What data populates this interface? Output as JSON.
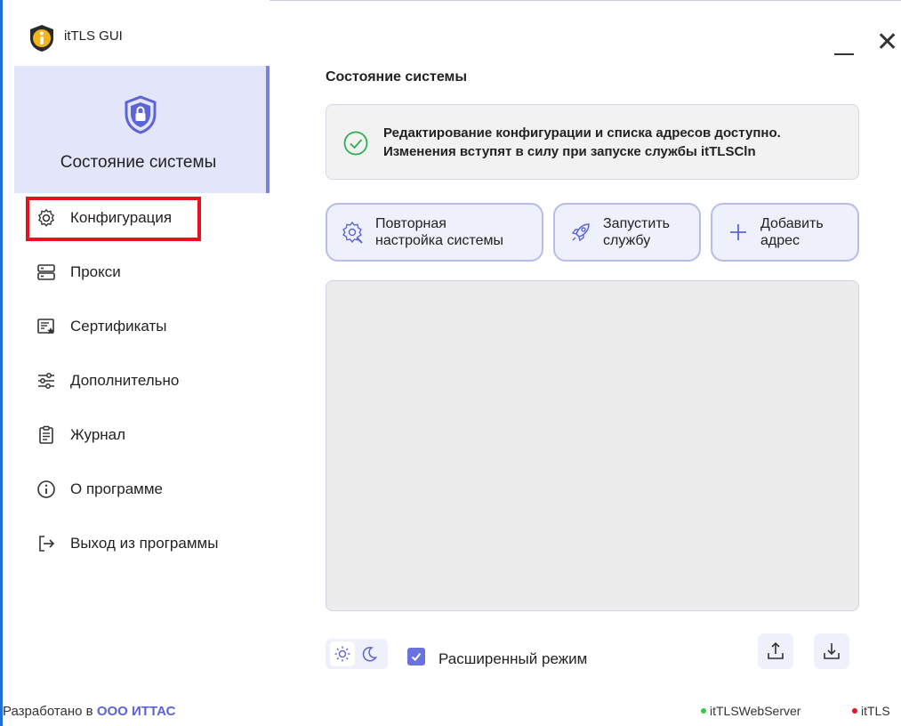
{
  "app": {
    "title": "itTLS GUI"
  },
  "sidebar": {
    "active_label": "Состояние системы",
    "items": [
      {
        "label": "Конфигурация",
        "icon": "gear-icon"
      },
      {
        "label": "Прокси",
        "icon": "server-icon"
      },
      {
        "label": "Сертификаты",
        "icon": "certificate-icon"
      },
      {
        "label": "Дополнительно",
        "icon": "sliders-icon"
      },
      {
        "label": "Журнал",
        "icon": "clipboard-icon"
      },
      {
        "label": "О программе",
        "icon": "info-icon"
      },
      {
        "label": "Выход из программы",
        "icon": "exit-icon"
      }
    ],
    "developer_prefix": "Разработано в",
    "developer_name": "ООО ИТТАС"
  },
  "main": {
    "title": "Состояние системы",
    "info_line1": "Редактирование конфигурации и списка адресов доступно.",
    "info_line2": "Изменения вступят в силу при запуске службы itTLSCln",
    "buttons": {
      "reconfig_line1": "Повторная",
      "reconfig_line2": "настройка системы",
      "start_line1": "Запустить",
      "start_line2": "службу",
      "add_line1": "Добавить",
      "add_line2": "адрес"
    },
    "advanced_mode_label": "Расширенный режим",
    "advanced_mode_checked": true
  },
  "statusbar": {
    "webserver": "itTLSWebServer",
    "webserver_color": "#2ecc40",
    "service": "itTLS",
    "service_color": "#e8111d"
  },
  "colors": {
    "accent": "#6a72dd",
    "active_bg": "#e3e5fb",
    "highlight": "#e8111d"
  }
}
